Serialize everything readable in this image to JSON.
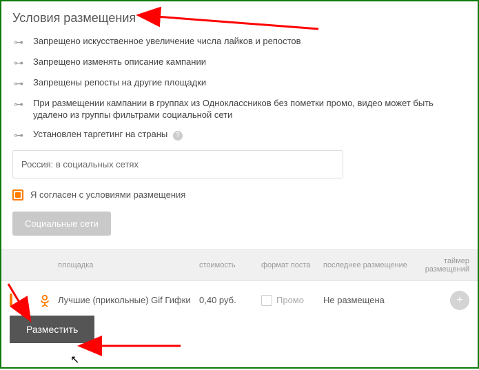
{
  "heading": "Условия размещения",
  "rules": [
    "Запрещено искусственное увеличение числа лайков и репостов",
    "Запрещено изменять описание кампании",
    "Запрещены репосты на другие площадки",
    "При размещении кампании в группах из Одноклассников без пометки промо, видео может быть удалено из группы фильтрами социальной сети",
    "Установлен таргетинг на страны"
  ],
  "target_tag": "Россия: в социальных сетях",
  "agree_label": "Я согласен с условиями размещения",
  "disabled_button_label": "Социальные сети",
  "table": {
    "headers": {
      "name": "площадка",
      "cost": "стоимость",
      "format": "формат поста",
      "last": "последнее размещение",
      "timer": "таймер размещений"
    },
    "row": {
      "name": "Лучшие (прикольные) Gif Гифки",
      "cost": "0,40 руб.",
      "format_label": "Промо",
      "last": "Не размещена"
    }
  },
  "submit_label": "Разместить",
  "colors": {
    "accent": "#ff7a00"
  }
}
